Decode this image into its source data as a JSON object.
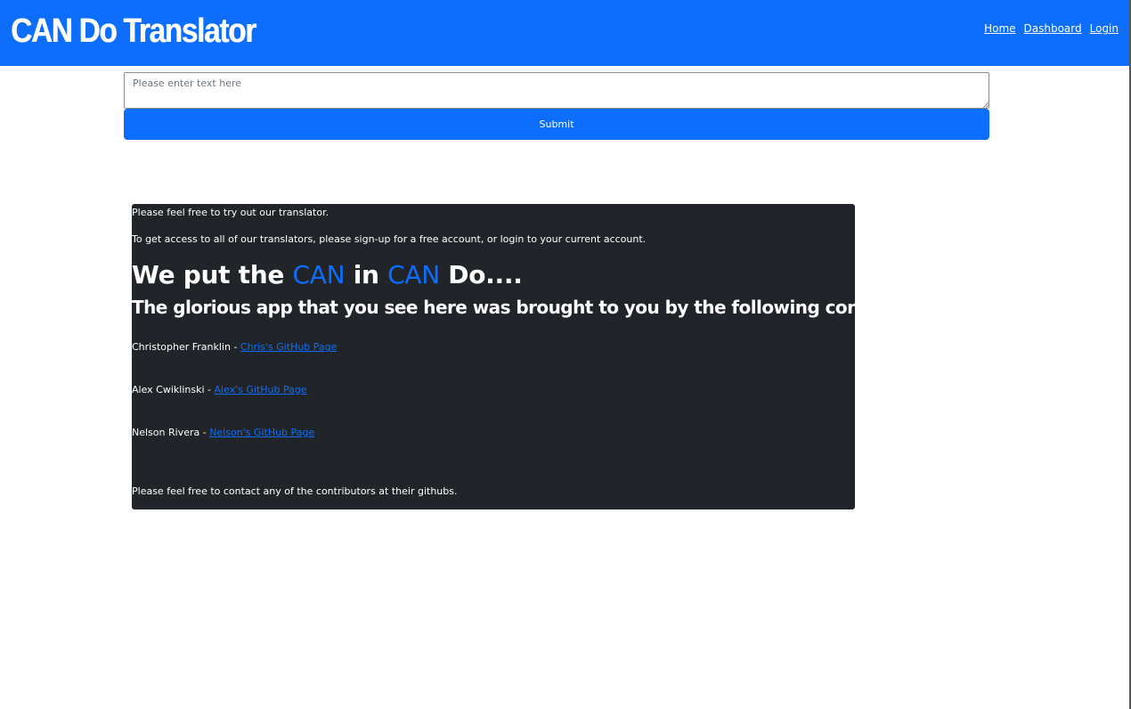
{
  "header": {
    "brand": "CAN Do Translator",
    "nav": [
      "Home",
      "Dashboard",
      "Login"
    ]
  },
  "form": {
    "placeholder": "Please enter text here",
    "value": "",
    "submit_label": "Submit"
  },
  "panel": {
    "intro": "Please feel free to try out our translator.",
    "signup": "To get access to all of our translators, please sign-up for a free account, or login to your current account.",
    "headline": {
      "part1": "We put the ",
      "can1": "CAN",
      "part2": " in ",
      "can2": "CAN",
      "part3": " Do...."
    },
    "subhead": "The glorious app that you see here was brought to you by the following contributors:",
    "contributors": [
      {
        "name": "Christopher Franklin - ",
        "link": "Chris's GitHub Page"
      },
      {
        "name": "Alex Cwiklinski - ",
        "link": "Alex's GitHub Page"
      },
      {
        "name": "Nelson Rivera - ",
        "link": "Nelson's GitHub Page"
      }
    ],
    "footer": "Please feel free to contact any of the contributors at their githubs."
  },
  "colors": {
    "primary": "#0d6efd",
    "panel_bg": "#212529",
    "text_light": "#ffffff"
  }
}
